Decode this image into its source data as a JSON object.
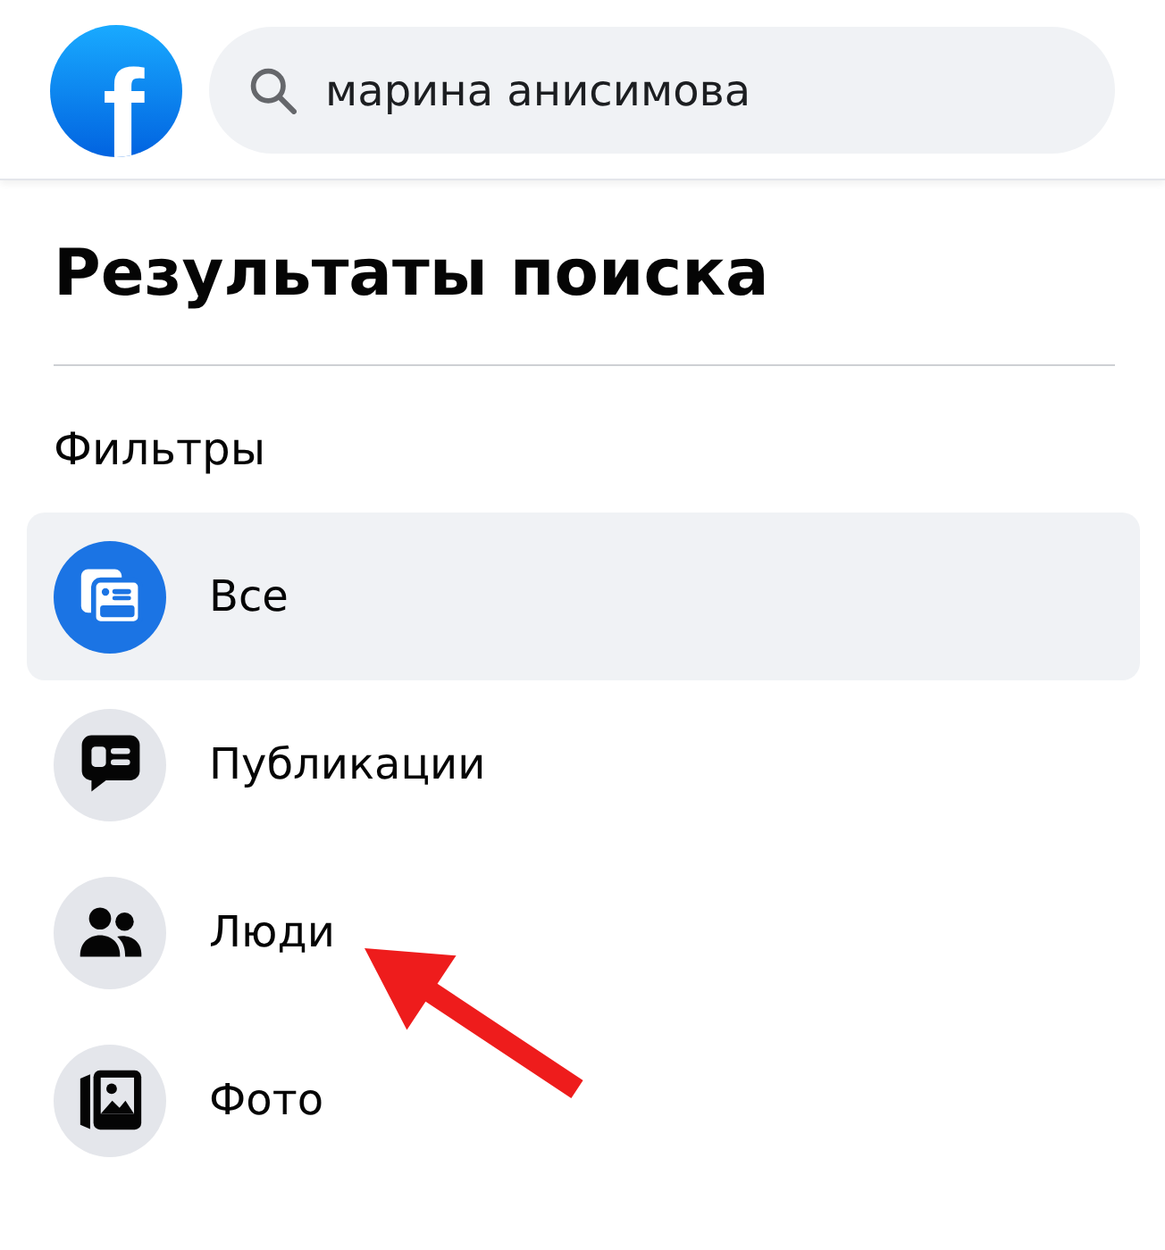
{
  "header": {
    "logo": "f",
    "search": {
      "value": "марина анисимова"
    }
  },
  "title": "Результаты поиска",
  "filters": {
    "heading": "Фильтры",
    "items": [
      {
        "label": "Все",
        "kind": "all",
        "selected": true,
        "arrow": false
      },
      {
        "label": "Публикации",
        "kind": "posts",
        "selected": false,
        "arrow": false
      },
      {
        "label": "Люди",
        "kind": "people",
        "selected": false,
        "arrow": true
      },
      {
        "label": "Фото",
        "kind": "photos",
        "selected": false,
        "arrow": false
      }
    ]
  }
}
